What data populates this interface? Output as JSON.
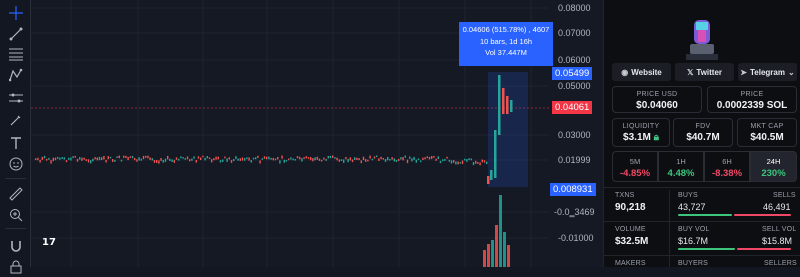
{
  "chart": {
    "y_axis_labels": [
      "0.08000",
      "0.07000",
      "0.06000",
      "0.05000",
      "0.03000",
      "0.01999",
      "-0.01000"
    ],
    "y_axis_partial": "-0.0‗3469",
    "price_tags": {
      "high": "0.05499",
      "current": "0.04061",
      "low": "0.008931"
    },
    "tooltip": {
      "line1": "0.04606 (515.78%) , 4607",
      "line2": "10 bars, 1d 16h",
      "line3": "Vol 37.447M"
    },
    "logo_text": "17",
    "colors": {
      "up": "#26a69a",
      "down": "#ef5350",
      "accent": "#2962ff",
      "current": "#f23645"
    }
  },
  "toolbar": {
    "tools": [
      "crosshair-icon",
      "trendline-icon",
      "fib-icon",
      "pattern-icon",
      "measure-icon",
      "brush-icon",
      "text-icon",
      "emoji-icon",
      "ruler-icon",
      "zoom-icon",
      "magnet-icon",
      "lock-icon"
    ]
  },
  "panel": {
    "links": [
      {
        "label": "Website",
        "icon": "globe-icon"
      },
      {
        "label": "Twitter",
        "icon": "x-icon"
      },
      {
        "label": "Telegram",
        "icon": "telegram-icon"
      }
    ],
    "price_usd": {
      "label": "PRICE USD",
      "value": "$0.04060"
    },
    "price_sol": {
      "label": "PRICE",
      "value": "0.0002339 SOL"
    },
    "liquidity": {
      "label": "LIQUIDITY",
      "value": "$3.1M"
    },
    "fdv": {
      "label": "FDV",
      "value": "$40.7M"
    },
    "mkt_cap": {
      "label": "MKT CAP",
      "value": "$40.5M"
    },
    "timeframes": [
      {
        "label": "5M",
        "value": "-4.85%",
        "dir": "red"
      },
      {
        "label": "1H",
        "value": "4.48%",
        "dir": "green"
      },
      {
        "label": "6H",
        "value": "-8.38%",
        "dir": "red"
      },
      {
        "label": "24H",
        "value": "230%",
        "dir": "green"
      }
    ],
    "txns": {
      "label": "TXNS",
      "value": "90,218"
    },
    "buys": {
      "label": "BUYS",
      "value": "43,727"
    },
    "sells": {
      "label": "SELLS",
      "value": "46,491"
    },
    "volume": {
      "label": "VOLUME",
      "value": "$32.5M"
    },
    "buy_vol": {
      "label": "BUY VOL",
      "value": "$16.7M"
    },
    "sell_vol": {
      "label": "SELL VOL",
      "value": "$15.8M"
    },
    "makers": {
      "label": "MAKERS"
    },
    "buyers": {
      "label": "BUYERS"
    },
    "sellers": {
      "label": "SELLERS"
    }
  }
}
